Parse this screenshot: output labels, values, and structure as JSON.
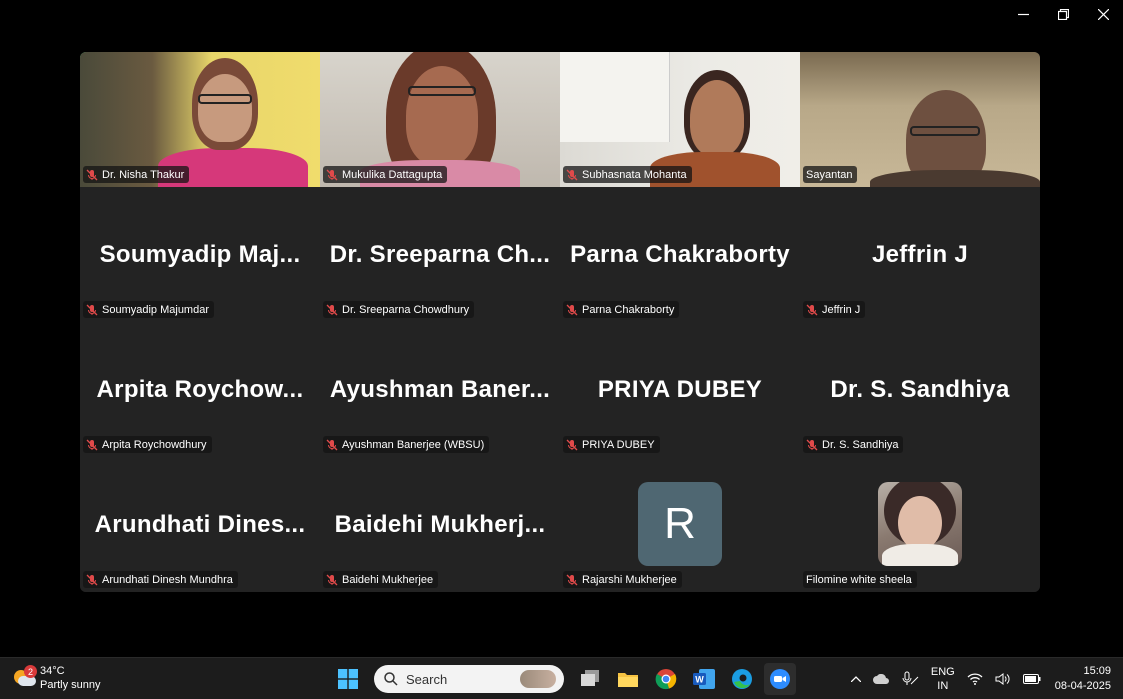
{
  "window": {
    "minimize_icon": "minimize-icon",
    "restore_icon": "restore-icon",
    "close_icon": "close-icon"
  },
  "meeting": {
    "participants": [
      {
        "display": "",
        "label": "Dr. Nisha Thakur",
        "muted": true,
        "video": true,
        "active": true
      },
      {
        "display": "",
        "label": "Mukulika Dattagupta",
        "muted": true,
        "video": true
      },
      {
        "display": "",
        "label": "Subhasnata Mohanta",
        "muted": true,
        "video": true
      },
      {
        "display": "",
        "label": "Sayantan",
        "muted": false,
        "video": true
      },
      {
        "display": "Soumyadip Maj...",
        "label": "Soumyadip Majumdar",
        "muted": true
      },
      {
        "display": "Dr. Sreeparna Ch...",
        "label": "Dr. Sreeparna Chowdhury",
        "muted": true
      },
      {
        "display": "Parna Chakraborty",
        "label": "Parna Chakraborty",
        "muted": true
      },
      {
        "display": "Jeffrin J",
        "label": "Jeffrin J",
        "muted": true
      },
      {
        "display": "Arpita Roychow...",
        "label": "Arpita Roychowdhury",
        "muted": true
      },
      {
        "display": "Ayushman Baner...",
        "label": "Ayushman Banerjee (WBSU)",
        "muted": true
      },
      {
        "display": "PRIYA DUBEY",
        "label": "PRIYA DUBEY",
        "muted": true
      },
      {
        "display": "Dr. S. Sandhiya",
        "label": "Dr. S. Sandhiya",
        "muted": true
      },
      {
        "display": "Arundhati Dines...",
        "label": "Arundhati Dinesh Mundhra",
        "muted": true
      },
      {
        "display": "Baidehi Mukherj...",
        "label": "Baidehi Mukherjee",
        "muted": true
      },
      {
        "display": "",
        "label": "Rajarshi Mukherjee",
        "muted": true,
        "avatar_letter": "R"
      },
      {
        "display": "",
        "label": "Filomine white sheela",
        "muted": false,
        "avatar_photo": true
      }
    ]
  },
  "taskbar": {
    "weather": {
      "temp": "34°C",
      "condition": "Partly sunny",
      "badge": "2"
    },
    "search_placeholder": "Search",
    "apps": [
      "start-icon",
      "search-icon",
      "task-view-icon",
      "file-explorer-icon",
      "chrome-icon",
      "word-icon",
      "edge-icon",
      "zoom-icon"
    ],
    "tray": {
      "lang_top": "ENG",
      "lang_bottom": "IN"
    },
    "clock": {
      "time": "15:09",
      "date": "08-04-2025"
    }
  },
  "colors": {
    "active_speaker": "#2ecc71",
    "muted_icon": "#e04a4a",
    "avatar_bg": "#4f6772"
  }
}
